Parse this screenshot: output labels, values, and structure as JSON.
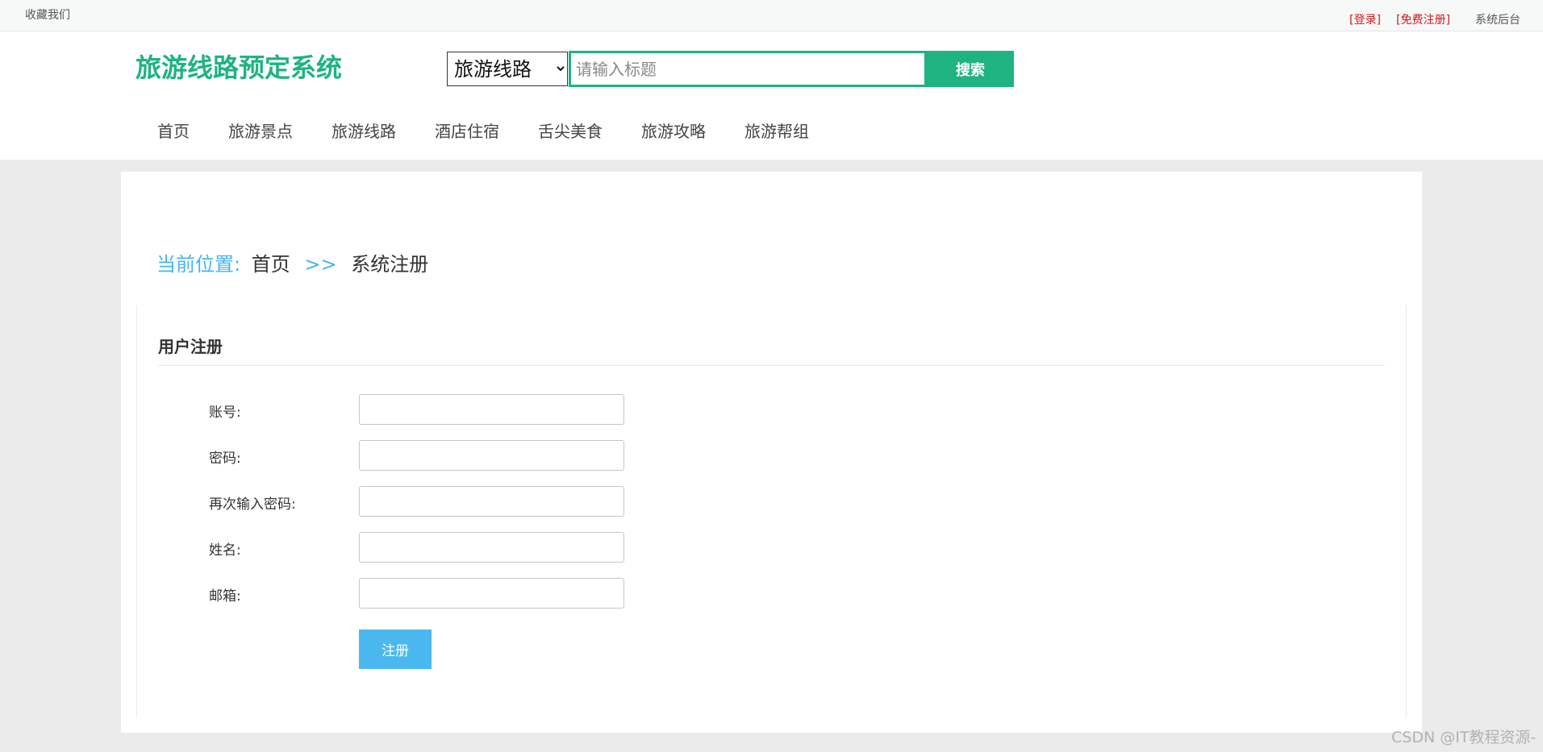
{
  "topbar": {
    "favorite": "收藏我们",
    "login": "[登录]",
    "register": "[免费注册]",
    "admin": "系统后台"
  },
  "header": {
    "logo": "旅游线路预定系统",
    "search": {
      "select_value": "旅游线路",
      "placeholder": "请输入标题",
      "button": "搜索"
    },
    "nav": [
      "首页",
      "旅游景点",
      "旅游线路",
      "酒店住宿",
      "舌尖美食",
      "旅游攻略",
      "旅游帮组"
    ]
  },
  "breadcrumb": {
    "label": "当前位置:",
    "home": "首页",
    "separator": ">>",
    "current": "系统注册"
  },
  "form": {
    "title": "用户注册",
    "fields": [
      {
        "label": "账号:",
        "value": ""
      },
      {
        "label": "密码:",
        "value": ""
      },
      {
        "label": "再次输入密码:",
        "value": ""
      },
      {
        "label": "姓名:",
        "value": ""
      },
      {
        "label": "邮箱:",
        "value": ""
      }
    ],
    "submit": "注册"
  },
  "watermark": "CSDN @IT教程资源-",
  "colors": {
    "brand_green": "#1fb381",
    "accent_blue": "#4ab8ef",
    "link_red": "#d01a1a",
    "page_bg": "#ebebeb"
  }
}
